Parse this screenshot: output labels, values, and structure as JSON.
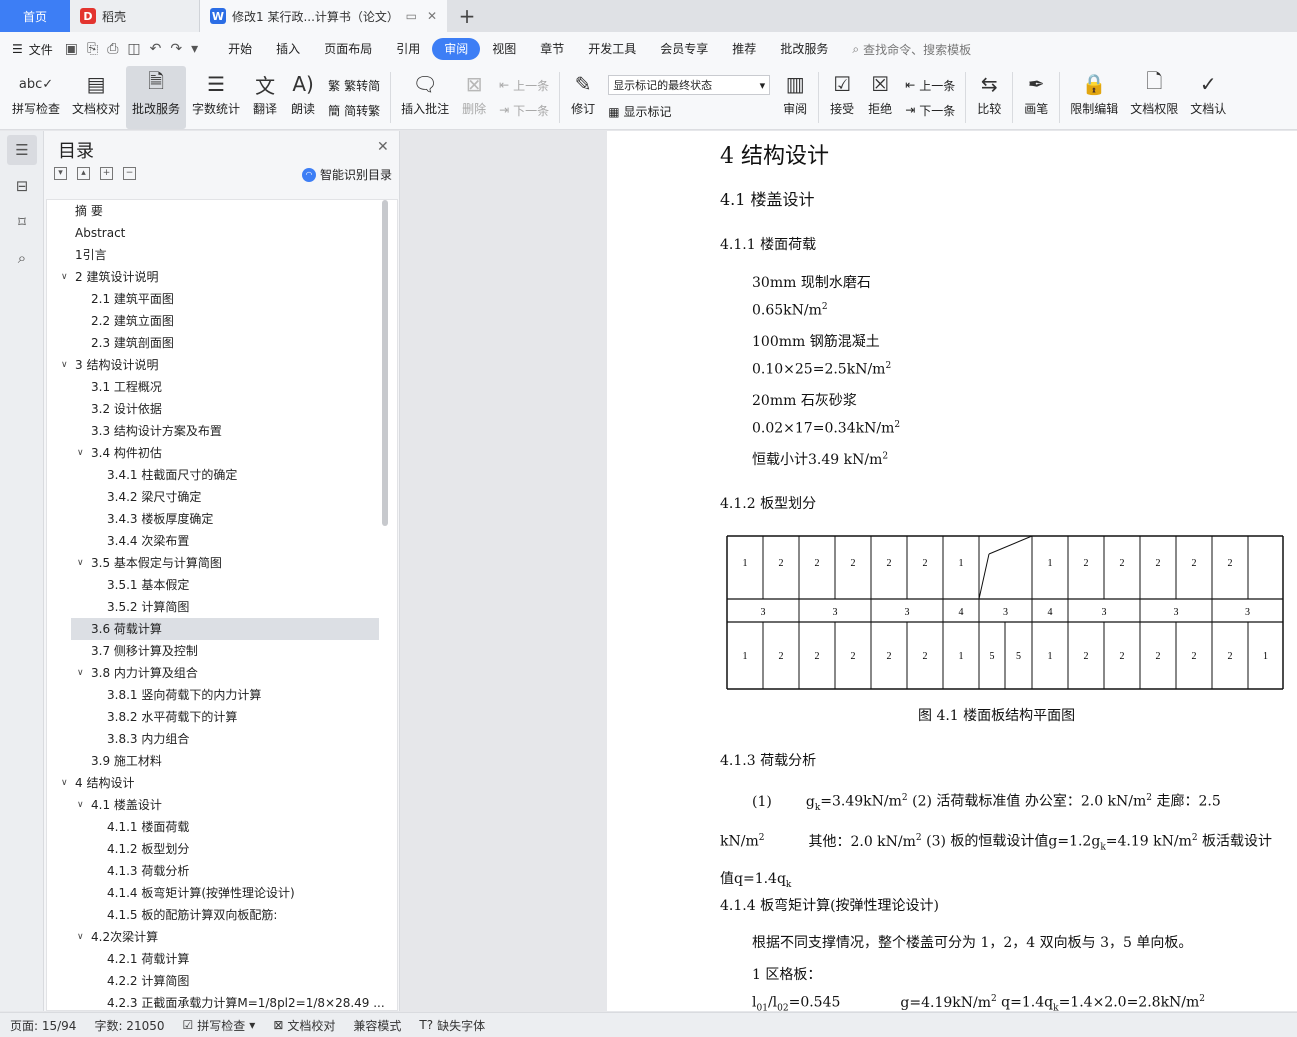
{
  "tabs": {
    "home": "首页",
    "daoke": "稻壳",
    "doc": "修改1 某行政...计算书（论文）"
  },
  "menu": {
    "file": "文件",
    "items": [
      "开始",
      "插入",
      "页面布局",
      "引用",
      "审阅",
      "视图",
      "章节",
      "开发工具",
      "会员专享",
      "推荐",
      "批改服务"
    ],
    "active": "审阅",
    "search": "查找命令、搜索模板"
  },
  "ribbon": {
    "spell": "拼写检查",
    "doccheck": "文档校对",
    "correct": "批改服务",
    "wordcount": "字数统计",
    "translate": "翻译",
    "read": "朗读",
    "trad": "繁转简",
    "simp": "简转繁",
    "insert_comment": "插入批注",
    "delete": "删除",
    "prev": "上一条",
    "next": "下一条",
    "revise": "修订",
    "markup_state": "显示标记的最终状态",
    "show_markup": "显示标记",
    "review": "审阅",
    "accept": "接受",
    "reject": "拒绝",
    "prev2": "上一条",
    "next2": "下一条",
    "compare": "比较",
    "pen": "画笔",
    "restrict": "限制编辑",
    "perm": "文档权限",
    "auth": "文档认"
  },
  "toc": {
    "title": "目录",
    "ai": "智能识别目录",
    "items": [
      {
        "text": "摘  要",
        "level": 0,
        "arrow": false
      },
      {
        "text": "Abstract",
        "level": 0,
        "arrow": false
      },
      {
        "text": "1引言",
        "level": 0,
        "arrow": false
      },
      {
        "text": "2 建筑设计说明",
        "level": 0,
        "arrow": true
      },
      {
        "text": "2.1 建筑平面图",
        "level": 1,
        "arrow": false
      },
      {
        "text": "2.2 建筑立面图",
        "level": 1,
        "arrow": false
      },
      {
        "text": "2.3 建筑剖面图",
        "level": 1,
        "arrow": false
      },
      {
        "text": "3 结构设计说明",
        "level": 0,
        "arrow": true
      },
      {
        "text": "3.1 工程概况",
        "level": 1,
        "arrow": false
      },
      {
        "text": "3.2 设计依据",
        "level": 1,
        "arrow": false
      },
      {
        "text": "3.3 结构设计方案及布置",
        "level": 1,
        "arrow": false
      },
      {
        "text": "3.4 构件初估",
        "level": 1,
        "arrow": true
      },
      {
        "text": "3.4.1 柱截面尺寸的确定",
        "level": 2,
        "arrow": false
      },
      {
        "text": "3.4.2 梁尺寸确定",
        "level": 2,
        "arrow": false
      },
      {
        "text": "3.4.3 楼板厚度确定",
        "level": 2,
        "arrow": false
      },
      {
        "text": "3.4.4 次梁布置",
        "level": 2,
        "arrow": false
      },
      {
        "text": "3.5 基本假定与计算简图",
        "level": 1,
        "arrow": true
      },
      {
        "text": "3.5.1 基本假定",
        "level": 2,
        "arrow": false
      },
      {
        "text": "3.5.2 计算简图",
        "level": 2,
        "arrow": false
      },
      {
        "text": "3.6 荷载计算",
        "level": 1,
        "arrow": false,
        "selected": true
      },
      {
        "text": "3.7 侧移计算及控制",
        "level": 1,
        "arrow": false
      },
      {
        "text": "3.8 内力计算及组合",
        "level": 1,
        "arrow": true
      },
      {
        "text": "3.8.1 竖向荷载下的内力计算",
        "level": 2,
        "arrow": false
      },
      {
        "text": "3.8.2 水平荷载下的计算",
        "level": 2,
        "arrow": false
      },
      {
        "text": "3.8.3 内力组合",
        "level": 2,
        "arrow": false
      },
      {
        "text": "3.9 施工材料",
        "level": 1,
        "arrow": false
      },
      {
        "text": "4 结构设计",
        "level": 0,
        "arrow": true
      },
      {
        "text": "4.1 楼盖设计",
        "level": 1,
        "arrow": true
      },
      {
        "text": "4.1.1 楼面荷载",
        "level": 2,
        "arrow": false
      },
      {
        "text": "4.1.2 板型划分",
        "level": 2,
        "arrow": false
      },
      {
        "text": "4.1.3 荷载分析",
        "level": 2,
        "arrow": false
      },
      {
        "text": "4.1.4 板弯矩计算(按弹性理论设计)",
        "level": 2,
        "arrow": false
      },
      {
        "text": "4.1.5 板的配筋计算双向板配筋:",
        "level": 2,
        "arrow": false
      },
      {
        "text": "4.2次梁计算",
        "level": 1,
        "arrow": true
      },
      {
        "text": "4.2.1 荷载计算",
        "level": 2,
        "arrow": false
      },
      {
        "text": "4.2.2 计算简图",
        "level": 2,
        "arrow": false
      },
      {
        "text": "4.2.3 正截面承载力计算M=1/8pl2=1/8×28.49 ...",
        "level": 2,
        "arrow": false
      }
    ]
  },
  "doc": {
    "h1": "4 结构设计",
    "h2": "4.1 楼盖设计",
    "s411": "4.1.1 楼面荷载",
    "l1": "30mm 现制水磨石",
    "l2": "0.65kN/m",
    "l3": "100mm 钢筋混凝土",
    "l4": "0.10×25=2.5kN/m",
    "l5": "20mm 石灰砂浆",
    "l6": "0.02×17=0.34kN/m",
    "l7": "恒载小计3.49 kN/m",
    "s412": "4.1.2 板型划分",
    "caption": "图 4.1 楼面板结构平面图",
    "s413": "4.1.3 荷载分析",
    "p1a": "(1)",
    "p1b": "=3.49kN/m",
    "p1c": " (2) 活荷载标准值    办公室：2.0 kN/m",
    "p1d": "  走廊：2.5",
    "p2a": "kN/m",
    "p2b": "其他：2.0 kN/m",
    "p2c": " (3) 板的恒载设计值g=1.2g",
    "p2d": "=4.19 kN/m",
    "p2e": " 板活载设计",
    "p3": "值q=1.4q",
    "s414": "4.1.4 板弯矩计算(按弹性理论设计)",
    "p4": "根据不同支撑情况，整个楼盖可分为 1，2，4 双向板与 3，5 单向板。",
    "p5": "1  区格板：",
    "p6a": "l",
    "p6b": "=0.545",
    "p6c": "g=4.19kN/m",
    "p6d": "  q=1.4q",
    "p6e": "=1.4×2.0=2.8kN/m",
    "plan_top": [
      "1",
      "2",
      "2",
      "2",
      "2",
      "2",
      "1",
      "",
      "1",
      "2",
      "2",
      "2",
      "2",
      "2"
    ],
    "plan_mid": [
      "3",
      "3",
      "3",
      "4",
      "3",
      "4",
      "3",
      "3",
      "3"
    ],
    "plan_bot": [
      "1",
      "2",
      "2",
      "2",
      "2",
      "2",
      "1",
      "5",
      "5",
      "1",
      "2",
      "2",
      "2",
      "2",
      "2",
      "1"
    ]
  },
  "status": {
    "page": "页面: 15/94",
    "words": "字数: 21050",
    "spell": "拼写检查",
    "check": "文档校对",
    "compat": "兼容模式",
    "font": "缺失字体"
  }
}
